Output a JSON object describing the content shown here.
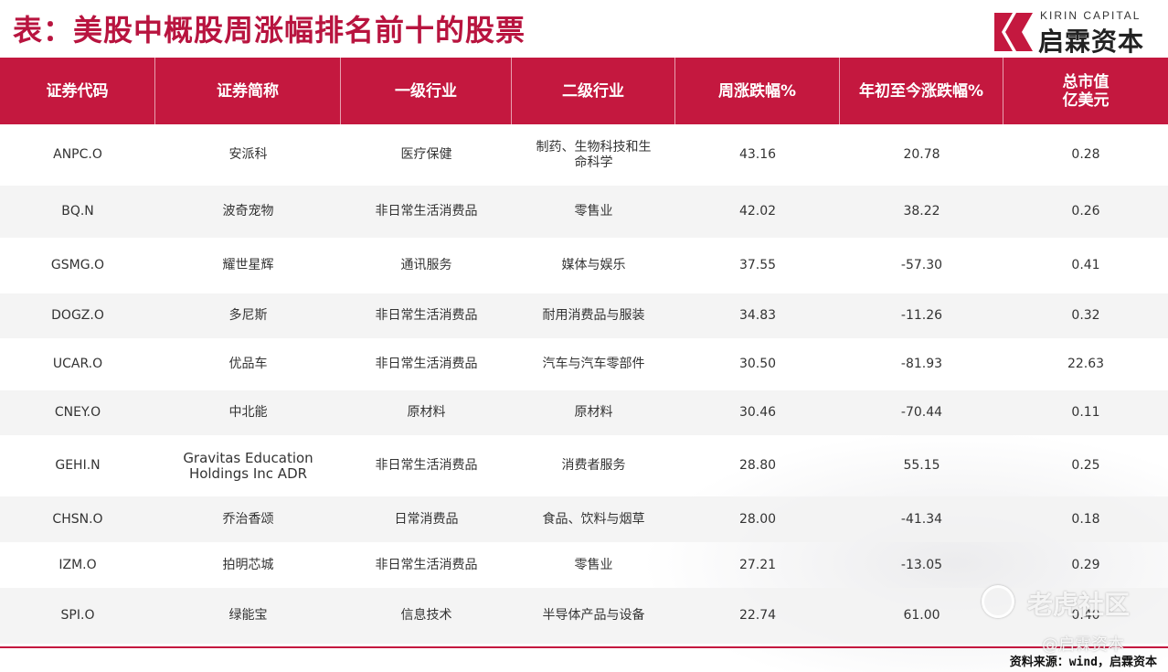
{
  "title": "表：美股中概股周涨幅排名前十的股票",
  "logo": {
    "en": "KIRIN CAPITAL",
    "cn": "启霖资本"
  },
  "colors": {
    "accent": "#c4183f",
    "title": "#b8143f"
  },
  "table": {
    "headers": [
      "证券代码",
      "证券简称",
      "一级行业",
      "二级行业",
      "周涨跌幅%",
      "年初至今涨跌幅%",
      "总市值\n亿美元"
    ],
    "rows": [
      [
        "ANPC.O",
        "安派科",
        "医疗保健",
        "制药、生物科技和生命科学",
        "43.16",
        "20.78",
        "0.28"
      ],
      [
        "BQ.N",
        "波奇宠物",
        "非日常生活消费品",
        "零售业",
        "42.02",
        "38.22",
        "0.26"
      ],
      [
        "GSMG.O",
        "耀世星辉",
        "通讯服务",
        "媒体与娱乐",
        "37.55",
        "-57.30",
        "0.41"
      ],
      [
        "DOGZ.O",
        "多尼斯",
        "非日常生活消费品",
        "耐用消费品与服装",
        "34.83",
        "-11.26",
        "0.32"
      ],
      [
        "UCAR.O",
        "优品车",
        "非日常生活消费品",
        "汽车与汽车零部件",
        "30.50",
        "-81.93",
        "22.63"
      ],
      [
        "CNEY.O",
        "中北能",
        "原材料",
        "原材料",
        "30.46",
        "-70.44",
        "0.11"
      ],
      [
        "GEHI.N",
        "Gravitas Education Holdings Inc ADR",
        "非日常生活消费品",
        "消费者服务",
        "28.80",
        "55.15",
        "0.25"
      ],
      [
        "CHSN.O",
        "乔治香颂",
        "日常消费品",
        "食品、饮料与烟草",
        "28.00",
        "-41.34",
        "0.18"
      ],
      [
        "IZM.O",
        "拍明芯城",
        "非日常生活消费品",
        "零售业",
        "27.21",
        "-13.05",
        "0.29"
      ],
      [
        "SPI.O",
        "绿能宝",
        "信息技术",
        "半导体产品与设备",
        "22.74",
        "61.00",
        "0.40"
      ]
    ]
  },
  "watermark": {
    "main": "老虎社区",
    "sub": "@启霖资本"
  },
  "source": "资料来源：wind，启霖资本"
}
